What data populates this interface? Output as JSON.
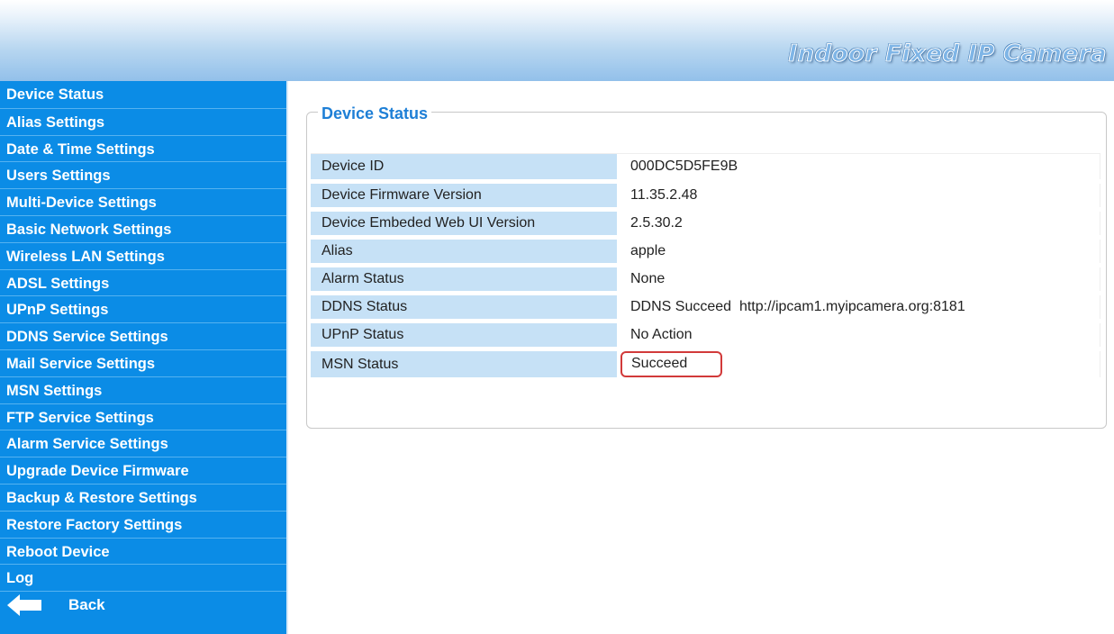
{
  "header": {
    "title": "Indoor Fixed IP Camera"
  },
  "sidebar": {
    "items": [
      {
        "label": "Device Status"
      },
      {
        "label": "Alias Settings"
      },
      {
        "label": "Date & Time Settings"
      },
      {
        "label": "Users Settings"
      },
      {
        "label": "Multi-Device Settings"
      },
      {
        "label": "Basic Network Settings"
      },
      {
        "label": "Wireless LAN Settings"
      },
      {
        "label": "ADSL Settings"
      },
      {
        "label": "UPnP Settings"
      },
      {
        "label": "DDNS Service Settings"
      },
      {
        "label": "Mail Service Settings"
      },
      {
        "label": "MSN Settings"
      },
      {
        "label": "FTP Service Settings"
      },
      {
        "label": "Alarm Service Settings"
      },
      {
        "label": "Upgrade Device Firmware"
      },
      {
        "label": "Backup & Restore Settings"
      },
      {
        "label": "Restore Factory Settings"
      },
      {
        "label": "Reboot Device"
      },
      {
        "label": "Log"
      }
    ],
    "back_label": "Back",
    "back_icon": "arrow-left-icon"
  },
  "main": {
    "section_title": "Device Status",
    "rows": [
      {
        "label": "Device ID",
        "value": "000DC5D5FE9B"
      },
      {
        "label": "Device Firmware Version",
        "value": "11.35.2.48"
      },
      {
        "label": "Device Embeded Web UI Version",
        "value": "2.5.30.2"
      },
      {
        "label": "Alias",
        "value": "apple"
      },
      {
        "label": "Alarm Status",
        "value": "None"
      },
      {
        "label": "DDNS Status",
        "value": "DDNS Succeed  http://ipcam1.myipcamera.org:8181"
      },
      {
        "label": "UPnP Status",
        "value": "No Action"
      },
      {
        "label": "MSN Status",
        "value": "Succeed"
      }
    ]
  },
  "colors": {
    "sidebar_bg": "#0b8ce6",
    "label_cell_bg": "#c6e1f6",
    "title_blue": "#1e7fd6",
    "highlight_red": "#d23a3a"
  }
}
